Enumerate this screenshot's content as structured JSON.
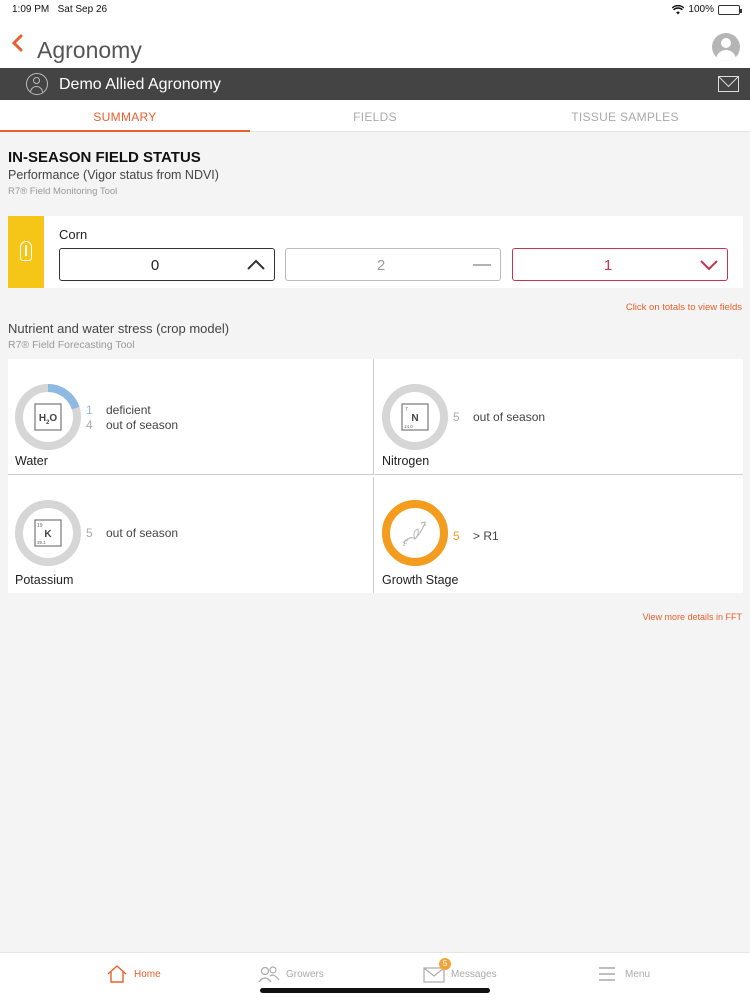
{
  "statusbar": {
    "time": "1:09 PM",
    "date": "Sat Sep 26",
    "battery": "100%"
  },
  "header": {
    "title": "Agronomy",
    "back_icon": "chevron-left-icon",
    "avatar_icon": "user-avatar-icon"
  },
  "account": {
    "name": "Demo Allied Agronomy"
  },
  "tabs": [
    {
      "label": "SUMMARY",
      "active": true
    },
    {
      "label": "FIELDS",
      "active": false
    },
    {
      "label": "TISSUE SAMPLES",
      "active": false
    }
  ],
  "field_status": {
    "title": "IN-SEASON FIELD STATUS",
    "subtitle": "Performance (Vigor status from NDVI)",
    "tool": "R7® Field Monitoring Tool",
    "crop": "Corn",
    "totals": [
      {
        "value": "0",
        "trend": "up"
      },
      {
        "value": "2",
        "trend": "flat"
      },
      {
        "value": "1",
        "trend": "down"
      }
    ],
    "hint": "Click on totals to view fields"
  },
  "stress": {
    "title": "Nutrient and water stress (crop model)",
    "tool": "R7® Field Forecasting Tool",
    "cards": [
      {
        "label": "Water",
        "icon_text": "H2O",
        "rows": [
          {
            "count": "1",
            "text": "deficient"
          },
          {
            "count": "4",
            "text": "out of season"
          }
        ],
        "fraction": 0.2
      },
      {
        "label": "Nitrogen",
        "icon_text": "N",
        "rows": [
          {
            "count": "5",
            "text": "out of season"
          }
        ],
        "fraction": 0
      },
      {
        "label": "Potassium",
        "icon_text": "K",
        "rows": [
          {
            "count": "5",
            "text": "out of season"
          }
        ],
        "fraction": 0
      },
      {
        "label": "Growth Stage",
        "icon_text": "",
        "rows": [
          {
            "count": "5",
            "text": "> R1"
          }
        ],
        "fraction": 1
      }
    ],
    "link": "View more details in FFT"
  },
  "colors": {
    "accent": "#e8602c",
    "corn": "#f5c518",
    "water": "#8db9e3",
    "growth": "#f39c1e",
    "down": "#c8344f"
  },
  "bottom_nav": [
    {
      "label": "Home",
      "icon": "home-icon",
      "active": true
    },
    {
      "label": "Growers",
      "icon": "growers-icon",
      "active": false
    },
    {
      "label": "Messages",
      "icon": "envelope-icon",
      "badge": "5",
      "active": false
    },
    {
      "label": "Menu",
      "icon": "menu-icon",
      "active": false
    }
  ]
}
